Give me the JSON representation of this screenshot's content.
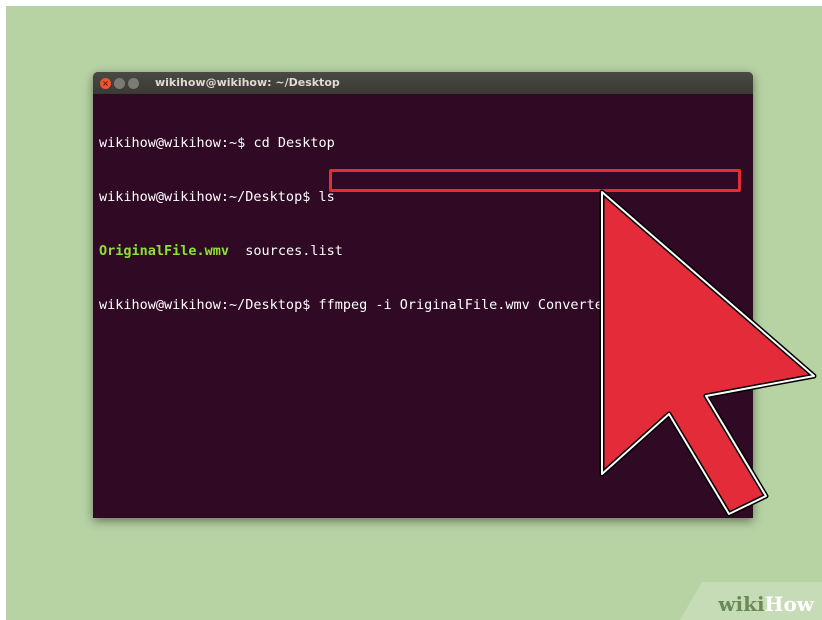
{
  "window": {
    "title": "wikihow@wikihow: ~/Desktop",
    "buttons": {
      "close": "×",
      "minimize": "",
      "maximize": ""
    }
  },
  "terminal": {
    "line1": {
      "prompt": "wikihow@wikihow:~$",
      "command": " cd Desktop"
    },
    "line2": {
      "prompt": "wikihow@wikihow:~/Desktop$",
      "command": " ls"
    },
    "line3": {
      "exe": "OriginalFile.wmv",
      "other": "  sources.list"
    },
    "line4": {
      "prompt": "wikihow@wikihow:~/Desktop$",
      "command": " ffmpeg -i OriginalFile.wmv ConvertedFile.avi"
    }
  },
  "watermark": {
    "wiki": "wiki",
    "how": "How"
  },
  "colors": {
    "background": "#b7d3a4",
    "terminal_bg": "#300a24",
    "highlight": "#e32b3a",
    "executable": "#8ae234"
  },
  "icons": [
    "close-icon",
    "minimize-icon",
    "maximize-icon",
    "cursor-arrow-icon"
  ]
}
